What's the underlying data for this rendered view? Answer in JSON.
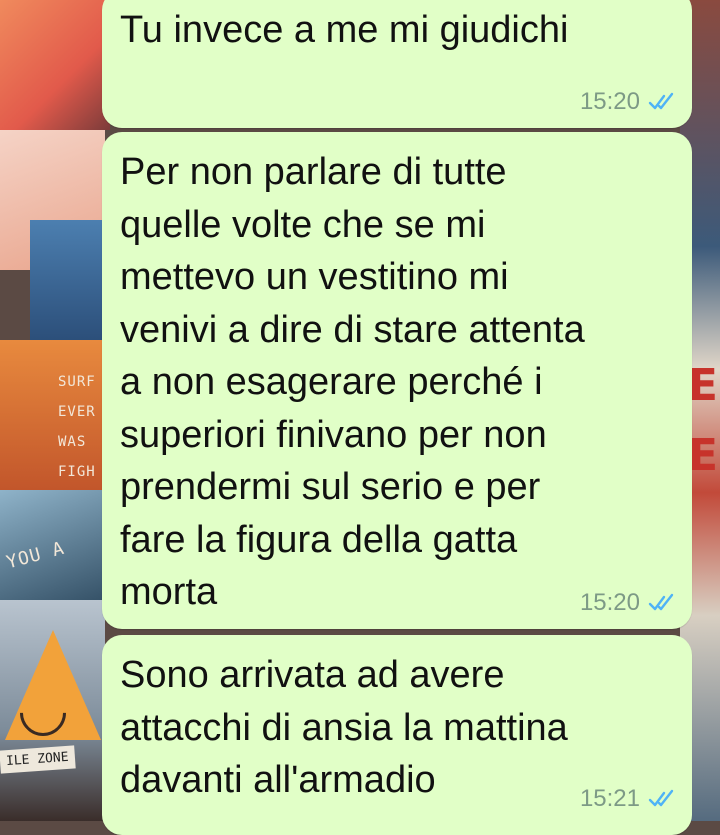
{
  "messages": [
    {
      "text": "Tu invece a me mi giudichi",
      "time": "15:20",
      "status": "read"
    },
    {
      "text": "Per non parlare di tutte\nquelle volte che se mi\nmettevo un vestitino mi\nvenivi a dire di stare attenta\na non esagerare perché i\nsuperiori finivano per non\nprendermi sul serio e per\nfare la figura della gatta\nmorta",
      "time": "15:20",
      "status": "read"
    },
    {
      "text": "Sono arrivata ad avere\nattacchi di ansia la mattina\ndavanti all'armadio",
      "time": "15:21",
      "status": "read"
    }
  ],
  "wallpaper": {
    "text_fragments": [
      "SURF",
      "EVER",
      "WAS",
      "FIGH",
      "YOU A",
      "ILE ZONE",
      "IE",
      "E"
    ]
  },
  "colors": {
    "bubble": "#e1ffc7",
    "read_ticks": "#4fb3f6",
    "timestamp": "#7d9a86"
  },
  "icons": {
    "read_receipt": "double-check-icon"
  }
}
